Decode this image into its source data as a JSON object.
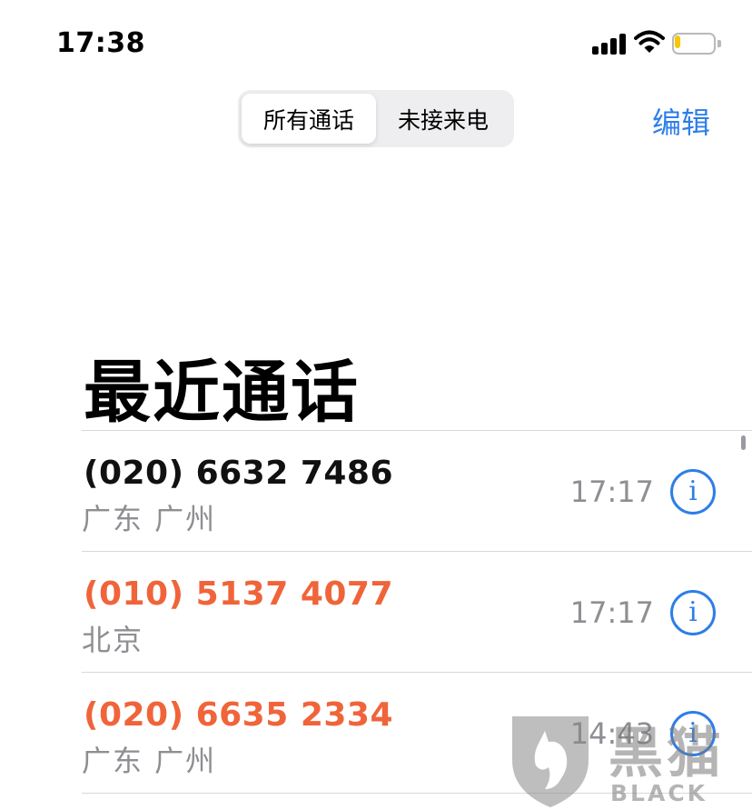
{
  "status_bar": {
    "time": "17:38",
    "signal_icon": "cellular-signal-icon",
    "wifi_icon": "wifi-icon",
    "battery_icon": "battery-icon",
    "battery_level": 0.15,
    "battery_color": "#f5c800"
  },
  "segmented": {
    "all_calls": "所有通话",
    "missed_calls": "未接来电"
  },
  "nav": {
    "edit_label": "编辑"
  },
  "page": {
    "title": "最近通话"
  },
  "calls": [
    {
      "number": "(020) 6632 7486",
      "location": "广东 广州",
      "time": "17:17",
      "missed": false,
      "info": "i"
    },
    {
      "number": "(010) 5137 4077",
      "location": "北京",
      "time": "17:17",
      "missed": true,
      "info": "i"
    },
    {
      "number": "(020) 6635 2334",
      "location": "广东 广州",
      "time": "14:43",
      "missed": true,
      "info": "i"
    }
  ],
  "colors": {
    "accent": "#2e7ee8",
    "missed": "#f0643a",
    "secondary_text": "#8e8e93"
  },
  "watermark": {
    "cn": "黑猫",
    "en": "BLACK CAT"
  }
}
